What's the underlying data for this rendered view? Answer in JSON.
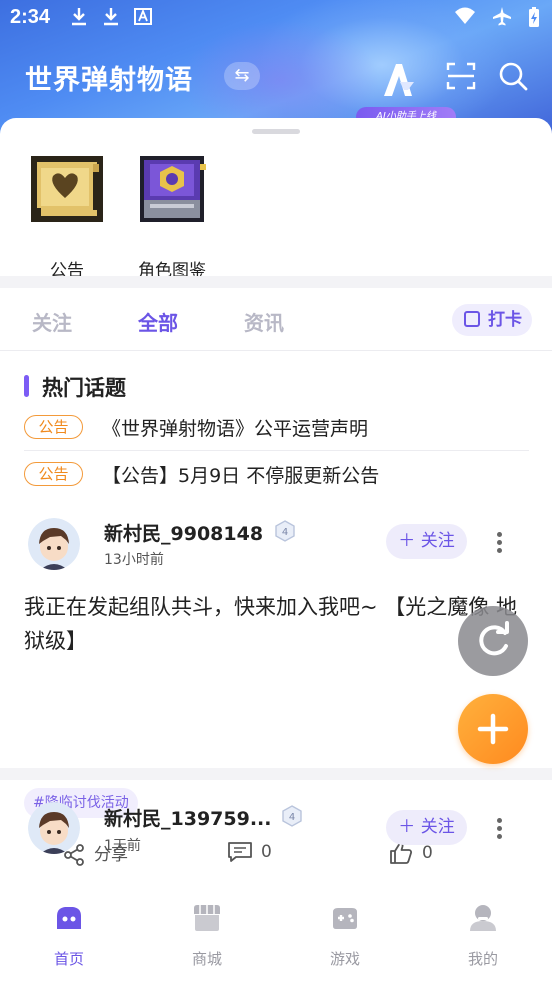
{
  "status_bar": {
    "time": "2:34",
    "left_icons": [
      "download-icon",
      "download-icon",
      "font-a-icon"
    ],
    "right_icons": [
      "wifi-icon",
      "airplane-icon",
      "battery-charging-icon"
    ]
  },
  "header": {
    "title": "世界弹射物语",
    "ai_badge": "AI小助手上线",
    "icons": [
      "switch-game-icon",
      "ai-assistant-logo",
      "scan-icon",
      "search-icon"
    ]
  },
  "shortcuts": [
    {
      "label": "公告",
      "icon": "scroll-heart-icon"
    },
    {
      "label": "角色图鉴",
      "icon": "character-book-icon"
    }
  ],
  "tabs": {
    "items": [
      "关注",
      "全部",
      "资讯"
    ],
    "active": "全部",
    "checkin_label": "打卡"
  },
  "hot_topics": {
    "title": "热门话题",
    "notices": [
      {
        "tag": "公告",
        "text": "《世界弹射物语》公平运营声明"
      },
      {
        "tag": "公告",
        "text": "【公告】5月9日 不停服更新公告"
      }
    ]
  },
  "posts": [
    {
      "author": "新村民_9908148",
      "level": "4",
      "time": "13小时前",
      "follow_label": "关注",
      "content": "我正在发起组队共斗，快来加入我吧~ 【光之魔像 地狱级】",
      "topic": "#降临讨伐活动",
      "share_label": "分享",
      "comments": "0",
      "likes": "0"
    },
    {
      "author": "新村民_139759...",
      "level": "4",
      "time": "1天前",
      "follow_label": "关注"
    }
  ],
  "bottom_nav": {
    "items": [
      {
        "label": "首页",
        "icon": "home-icon"
      },
      {
        "label": "商城",
        "icon": "shop-icon"
      },
      {
        "label": "游戏",
        "icon": "gamepad-icon"
      },
      {
        "label": "我的",
        "icon": "profile-icon"
      }
    ],
    "active": "首页"
  },
  "colors": {
    "accent": "#6b55e6",
    "notice_tag": "#f08a1e",
    "fab_add": "#ff9a2a",
    "fab_refresh": "#8a8a8f"
  }
}
